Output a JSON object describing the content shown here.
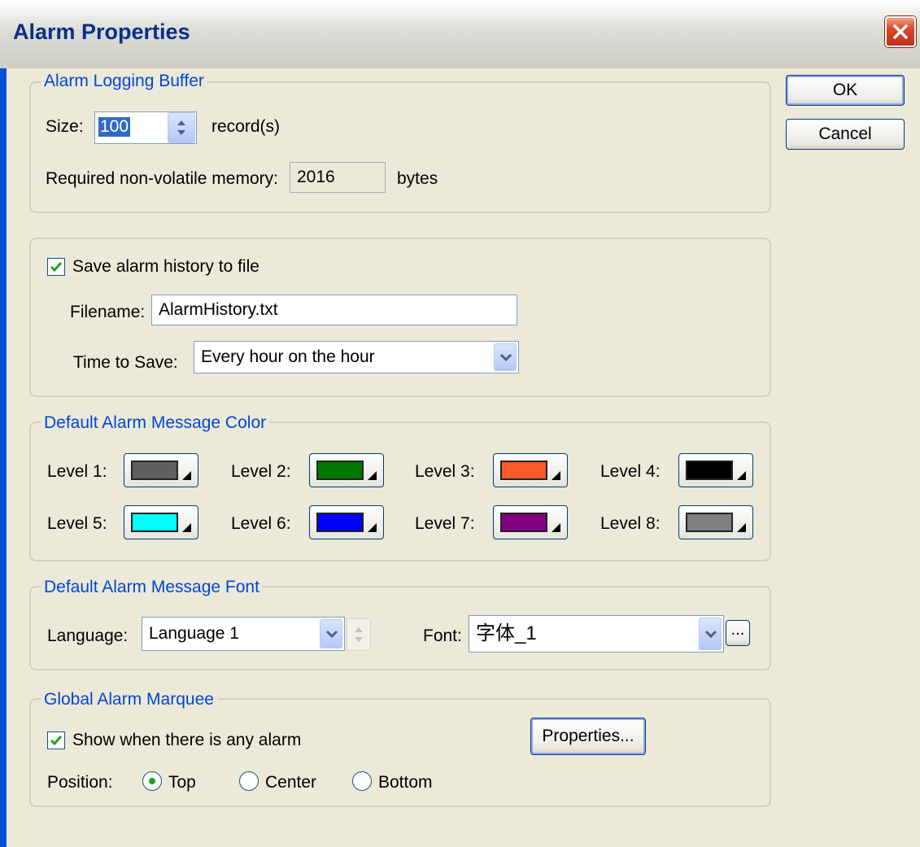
{
  "window": {
    "title": "Alarm Properties"
  },
  "buttons": {
    "ok": "OK",
    "cancel": "Cancel",
    "properties": "Properties...",
    "browse": "..."
  },
  "buffer": {
    "legend": "Alarm Logging Buffer",
    "size_label": "Size:",
    "size_value": "100",
    "size_unit": "record(s)",
    "memory_label": "Required non-volatile memory:",
    "memory_value": "2016",
    "memory_unit": "bytes"
  },
  "history": {
    "checkbox_label": "Save alarm history to file",
    "checked": true,
    "filename_label": "Filename:",
    "filename_value": "AlarmHistory.txt",
    "time_label": "Time to Save:",
    "time_value": "Every hour on the hour"
  },
  "colors": {
    "legend": "Default Alarm Message Color",
    "levels": [
      {
        "label": "Level 1:",
        "color": "#606060"
      },
      {
        "label": "Level 2:",
        "color": "#007800"
      },
      {
        "label": "Level 3:",
        "color": "#ff5a28"
      },
      {
        "label": "Level 4:",
        "color": "#000000"
      },
      {
        "label": "Level 5:",
        "color": "#00ffff"
      },
      {
        "label": "Level 6:",
        "color": "#0000ff"
      },
      {
        "label": "Level 7:",
        "color": "#800080"
      },
      {
        "label": "Level 8:",
        "color": "#808080"
      }
    ]
  },
  "font": {
    "legend": "Default Alarm Message Font",
    "language_label": "Language:",
    "language_value": "Language 1",
    "font_label": "Font:",
    "font_value": "字体_1"
  },
  "marquee": {
    "legend": "Global Alarm Marquee",
    "checkbox_label": "Show when there is any alarm",
    "checked": true,
    "position_label": "Position:",
    "positions": [
      "Top",
      "Center",
      "Bottom"
    ],
    "selected_position": "Top"
  }
}
